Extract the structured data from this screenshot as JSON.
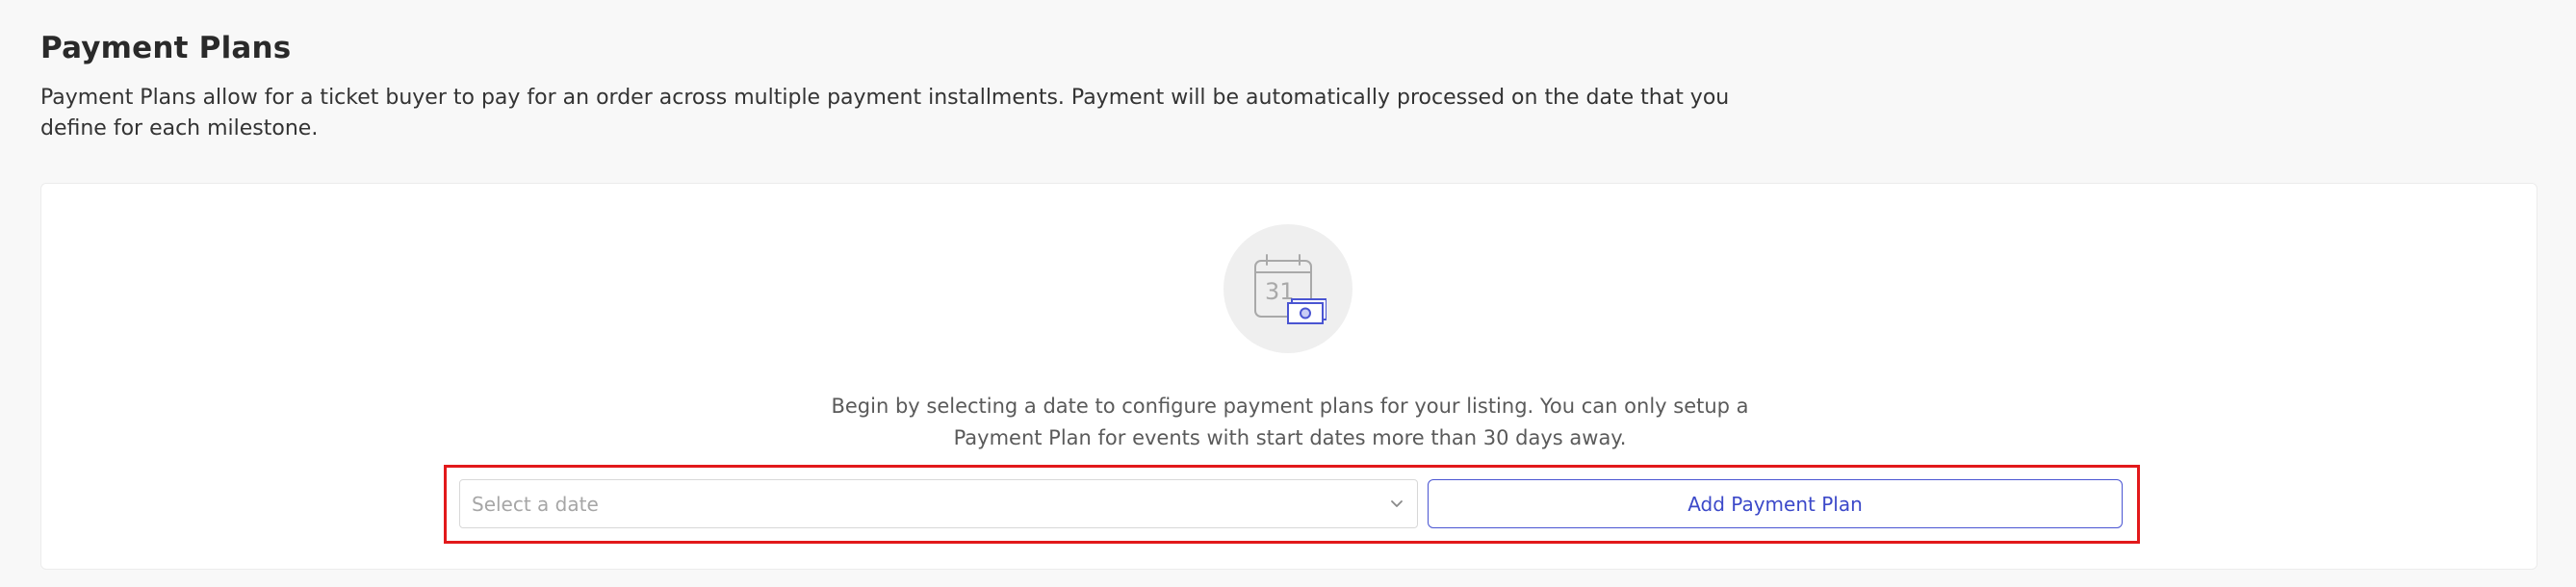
{
  "header": {
    "title": "Payment Plans",
    "description": "Payment Plans allow for a ticket buyer to pay for an order across multiple payment installments. Payment will be automatically processed on the date that you define for each milestone."
  },
  "empty_state": {
    "icon": "calendar-with-money-icon",
    "calendar_number": "31",
    "message": "Begin by selecting a date to configure payment plans for your listing. You can only setup a Payment Plan for events with start dates more than 30 days away."
  },
  "controls": {
    "date_select": {
      "placeholder": "Select a date",
      "value": ""
    },
    "add_button_label": "Add Payment Plan"
  },
  "colors": {
    "accent": "#3c49c9",
    "highlight": "#e2191b",
    "page_background": "#f8f8f8",
    "panel_background": "#ffffff"
  }
}
